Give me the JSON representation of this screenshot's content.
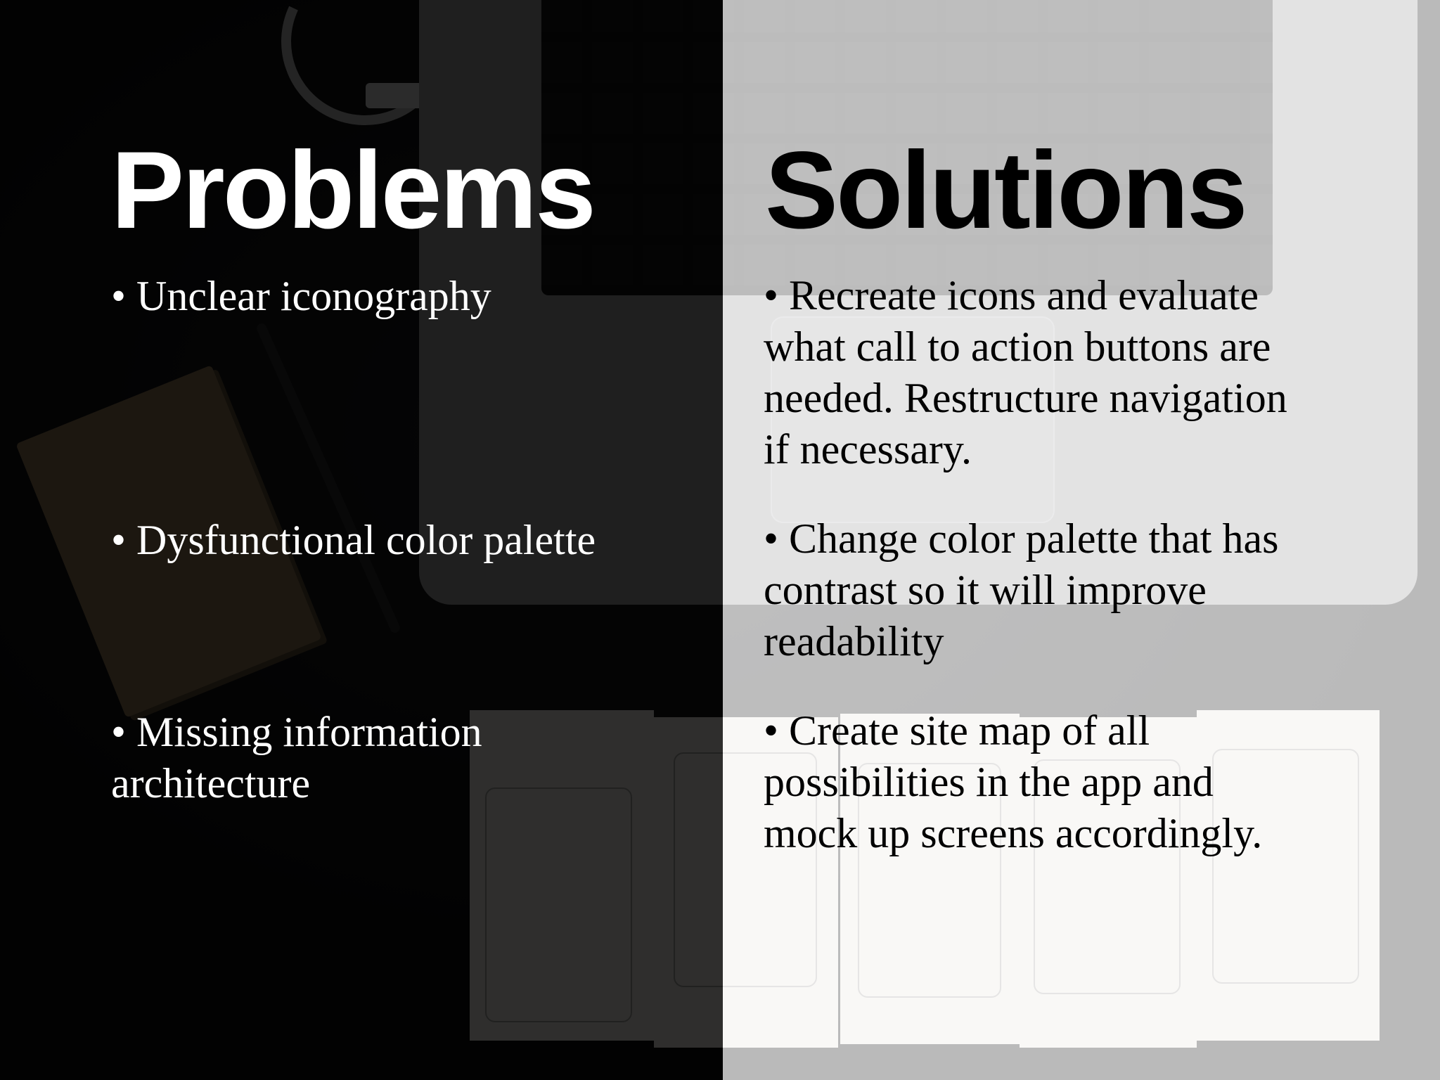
{
  "slide": {
    "problems": {
      "heading": "Problems",
      "items": [
        "• Unclear iconography",
        "• Dysfunctional color palette",
        "• Missing information\narchitecture"
      ]
    },
    "solutions": {
      "heading": "Solutions",
      "items": [
        "• Recreate icons and evaluate\nwhat call to action buttons are\nneeded. Restructure navigation\nif  necessary.",
        "• Change color palette that has\ncontrast so it will improve\nreadability",
        "• Create site map of  all\npossibilities in the app and\nmock up screens accordingly."
      ]
    }
  },
  "colors": {
    "left_overlay": "#000000",
    "right_overlay": "#ffffff",
    "left_text": "#ffffff",
    "right_text": "#000000"
  }
}
